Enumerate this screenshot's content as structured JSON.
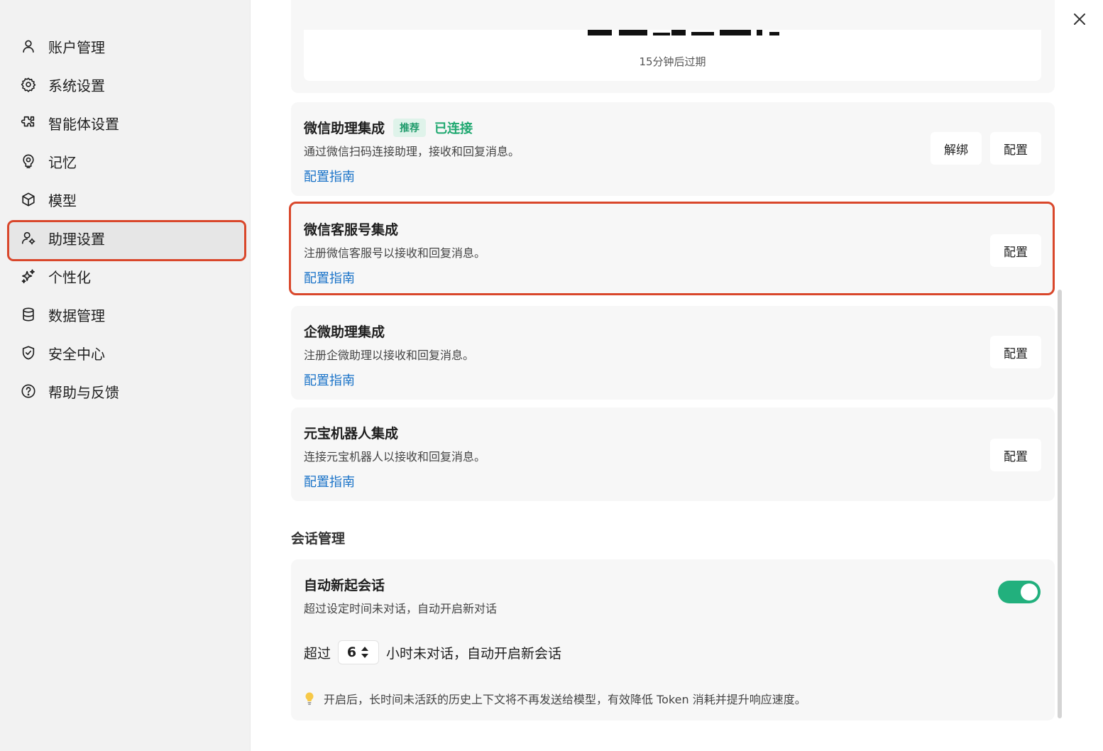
{
  "sidebar": {
    "items": [
      {
        "label": "账户管理",
        "icon": "user-icon"
      },
      {
        "label": "系统设置",
        "icon": "gear-icon"
      },
      {
        "label": "智能体设置",
        "icon": "puzzle-icon"
      },
      {
        "label": "记忆",
        "icon": "memory-icon"
      },
      {
        "label": "模型",
        "icon": "cube-icon"
      },
      {
        "label": "助理设置",
        "icon": "user-gear-icon",
        "active": true
      },
      {
        "label": "个性化",
        "icon": "sparkle-icon"
      },
      {
        "label": "数据管理",
        "icon": "database-icon"
      },
      {
        "label": "安全中心",
        "icon": "shield-check-icon"
      },
      {
        "label": "帮助与反馈",
        "icon": "question-circle-icon"
      }
    ]
  },
  "qr": {
    "expire_text": "15分钟后过期"
  },
  "integrations": [
    {
      "title": "微信助理集成",
      "badge_recommend": "推荐",
      "badge_status": "已连接",
      "desc": "通过微信扫码连接助理，接收和回复消息。",
      "link": "配置指南",
      "unbind_label": "解绑",
      "config_label": "配置"
    },
    {
      "title": "微信客服号集成",
      "desc": "注册微信客服号以接收和回复消息。",
      "link": "配置指南",
      "config_label": "配置"
    },
    {
      "title": "企微助理集成",
      "desc": "注册企微助理以接收和回复消息。",
      "link": "配置指南",
      "config_label": "配置"
    },
    {
      "title": "元宝机器人集成",
      "desc": "连接元宝机器人以接收和回复消息。",
      "link": "配置指南",
      "config_label": "配置"
    }
  ],
  "session": {
    "section_title": "会话管理",
    "title": "自动新起会话",
    "desc": "超过设定时间未对话，自动开启新对话",
    "toggle_on": true,
    "prefix": "超过",
    "hours": "6",
    "suffix": "小时未对话，自动开启新会话",
    "tip": "开启后，长时间未活跃的历史上下文将不再发送给模型，有效降低 Token 消耗并提升响应速度。"
  },
  "colors": {
    "accent_green": "#22b07d",
    "link_blue": "#1a73c8",
    "highlight_red": "#d9472b"
  }
}
